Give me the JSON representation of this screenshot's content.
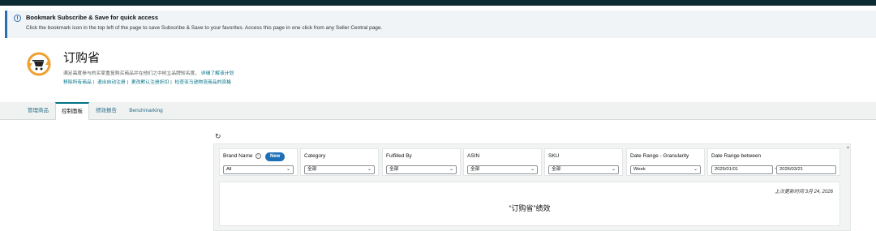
{
  "banner": {
    "title": "Bookmark Subscribe & Save for quick access",
    "text": "Click the bookmark icon in the top left of the page to save Subscribe & Save to your favorites. Access this page in one click from any Seller Central page."
  },
  "page": {
    "title": "订购省",
    "description": "满足高度参与的买家重复购买商品并在他们之中树立品牌知名度。",
    "learn_more": "详细了解该计划",
    "links": [
      "移除所有商品",
      "退出自动注册",
      "更改默认注册折扣",
      "检查亚马逊物流商品的资格"
    ],
    "logo_icon": "subscribe-save-cart-icon"
  },
  "tabs": [
    {
      "label": "管理商品",
      "active": false
    },
    {
      "label": "控制面板",
      "active": true
    },
    {
      "label": "绩效报告",
      "active": false
    },
    {
      "label": "Benchmarking",
      "active": false
    }
  ],
  "dashboard": {
    "refresh_icon": "↻",
    "filters": {
      "brand": {
        "label": "Brand Name",
        "badge": "New",
        "value": "All"
      },
      "category": {
        "label": "Category",
        "value": "全部"
      },
      "fulfilled_by": {
        "label": "Fulfilled By",
        "value": "全部"
      },
      "asin": {
        "label": "ASIN",
        "value": "全部"
      },
      "sku": {
        "label": "SKU",
        "value": "全部"
      },
      "granularity": {
        "label": "Date Range - Granularity",
        "value": "Week"
      },
      "date_range": {
        "label": "Date Range between",
        "start": "2025/01/01",
        "end": "2026/03/21"
      }
    },
    "last_updated": "上次更新时间 3月 24, 2026",
    "performance_title": "“订购省”绩效"
  },
  "colors": {
    "accent": "#007185",
    "badge": "#1f6fb8",
    "topbar": "#0c2b32",
    "banner_border": "#2a6fb2"
  }
}
